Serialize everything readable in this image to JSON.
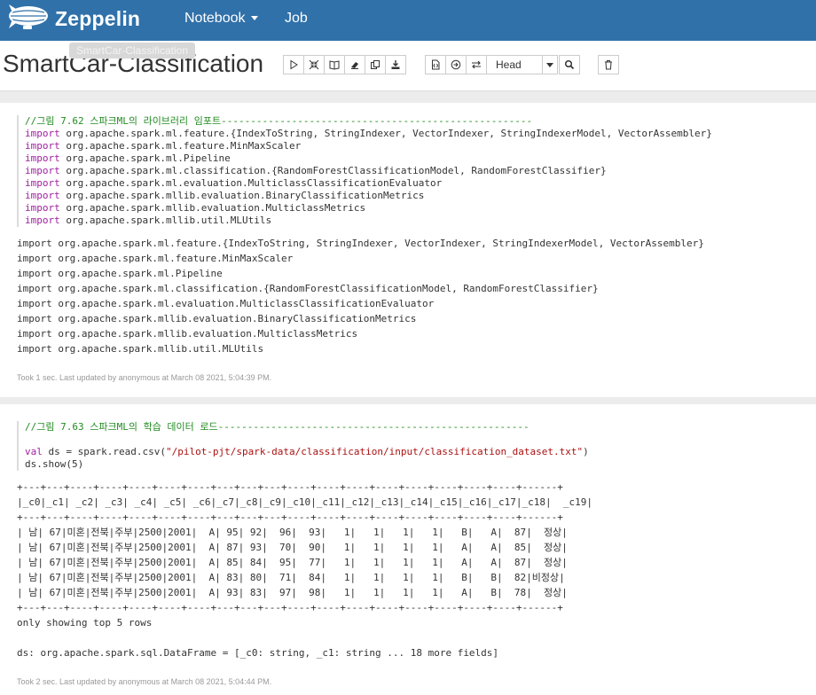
{
  "navbar": {
    "brand": "Zeppelin",
    "notebook_label": "Notebook",
    "job_label": "Job"
  },
  "header": {
    "title": "SmartCar-Classification",
    "tooltip": "SmartCar-Classification",
    "head_label": "Head"
  },
  "paragraphs": [
    {
      "code": [
        "//그림 7.62 스파크ML의 라이브러리 임포트-----------------------------------------------------",
        "import org.apache.spark.ml.feature.{IndexToString, StringIndexer, VectorIndexer, StringIndexerModel, VectorAssembler}",
        "import org.apache.spark.ml.feature.MinMaxScaler",
        "import org.apache.spark.ml.Pipeline",
        "import org.apache.spark.ml.classification.{RandomForestClassificationModel, RandomForestClassifier}",
        "import org.apache.spark.ml.evaluation.MulticlassClassificationEvaluator",
        "import org.apache.spark.mllib.evaluation.BinaryClassificationMetrics",
        "import org.apache.spark.mllib.evaluation.MulticlassMetrics",
        "import org.apache.spark.mllib.util.MLUtils"
      ],
      "output": "import org.apache.spark.ml.feature.{IndexToString, StringIndexer, VectorIndexer, StringIndexerModel, VectorAssembler}\nimport org.apache.spark.ml.feature.MinMaxScaler\nimport org.apache.spark.ml.Pipeline\nimport org.apache.spark.ml.classification.{RandomForestClassificationModel, RandomForestClassifier}\nimport org.apache.spark.ml.evaluation.MulticlassClassificationEvaluator\nimport org.apache.spark.mllib.evaluation.BinaryClassificationMetrics\nimport org.apache.spark.mllib.evaluation.MulticlassMetrics\nimport org.apache.spark.mllib.util.MLUtils",
      "status": "Took 1 sec. Last updated by anonymous at March 08 2021, 5:04:39 PM."
    },
    {
      "code": [
        "//그림 7.63 스파크ML의 학습 데이터 로드-----------------------------------------------------",
        "",
        "val ds = spark.read.csv(\"/pilot-pjt/spark-data/classification/input/classification_dataset.txt\")",
        "ds.show(5)"
      ],
      "output": "+---+---+----+----+----+----+----+---+---+---+----+----+----+----+----+----+----+----+------+\n|_c0|_c1| _c2| _c3| _c4| _c5| _c6|_c7|_c8|_c9|_c10|_c11|_c12|_c13|_c14|_c15|_c16|_c17|_c18|  _c19|\n+---+---+----+----+----+----+----+---+---+---+----+----+----+----+----+----+----+----+------+\n| 남| 67|미혼|전북|주부|2500|2001|  A| 95| 92|  96|  93|   1|   1|   1|   1|   B|   A|  87|  정상|\n| 남| 67|미혼|전북|주부|2500|2001|  A| 87| 93|  70|  90|   1|   1|   1|   1|   A|   A|  85|  정상|\n| 남| 67|미혼|전북|주부|2500|2001|  A| 85| 84|  95|  77|   1|   1|   1|   1|   A|   A|  87|  정상|\n| 남| 67|미혼|전북|주부|2500|2001|  A| 83| 80|  71|  84|   1|   1|   1|   1|   B|   B|  82|비정상|\n| 남| 67|미혼|전북|주부|2500|2001|  A| 93| 83|  97|  98|   1|   1|   1|   1|   A|   B|  78|  정상|\n+---+---+----+----+----+----+----+---+---+---+----+----+----+----+----+----+----+----+------+\nonly showing top 5 rows\n\nds: org.apache.spark.sql.DataFrame = [_c0: string, _c1: string ... 18 more fields]",
      "status": "Took 2 sec. Last updated by anonymous at March 08 2021, 5:04:44 PM."
    }
  ]
}
